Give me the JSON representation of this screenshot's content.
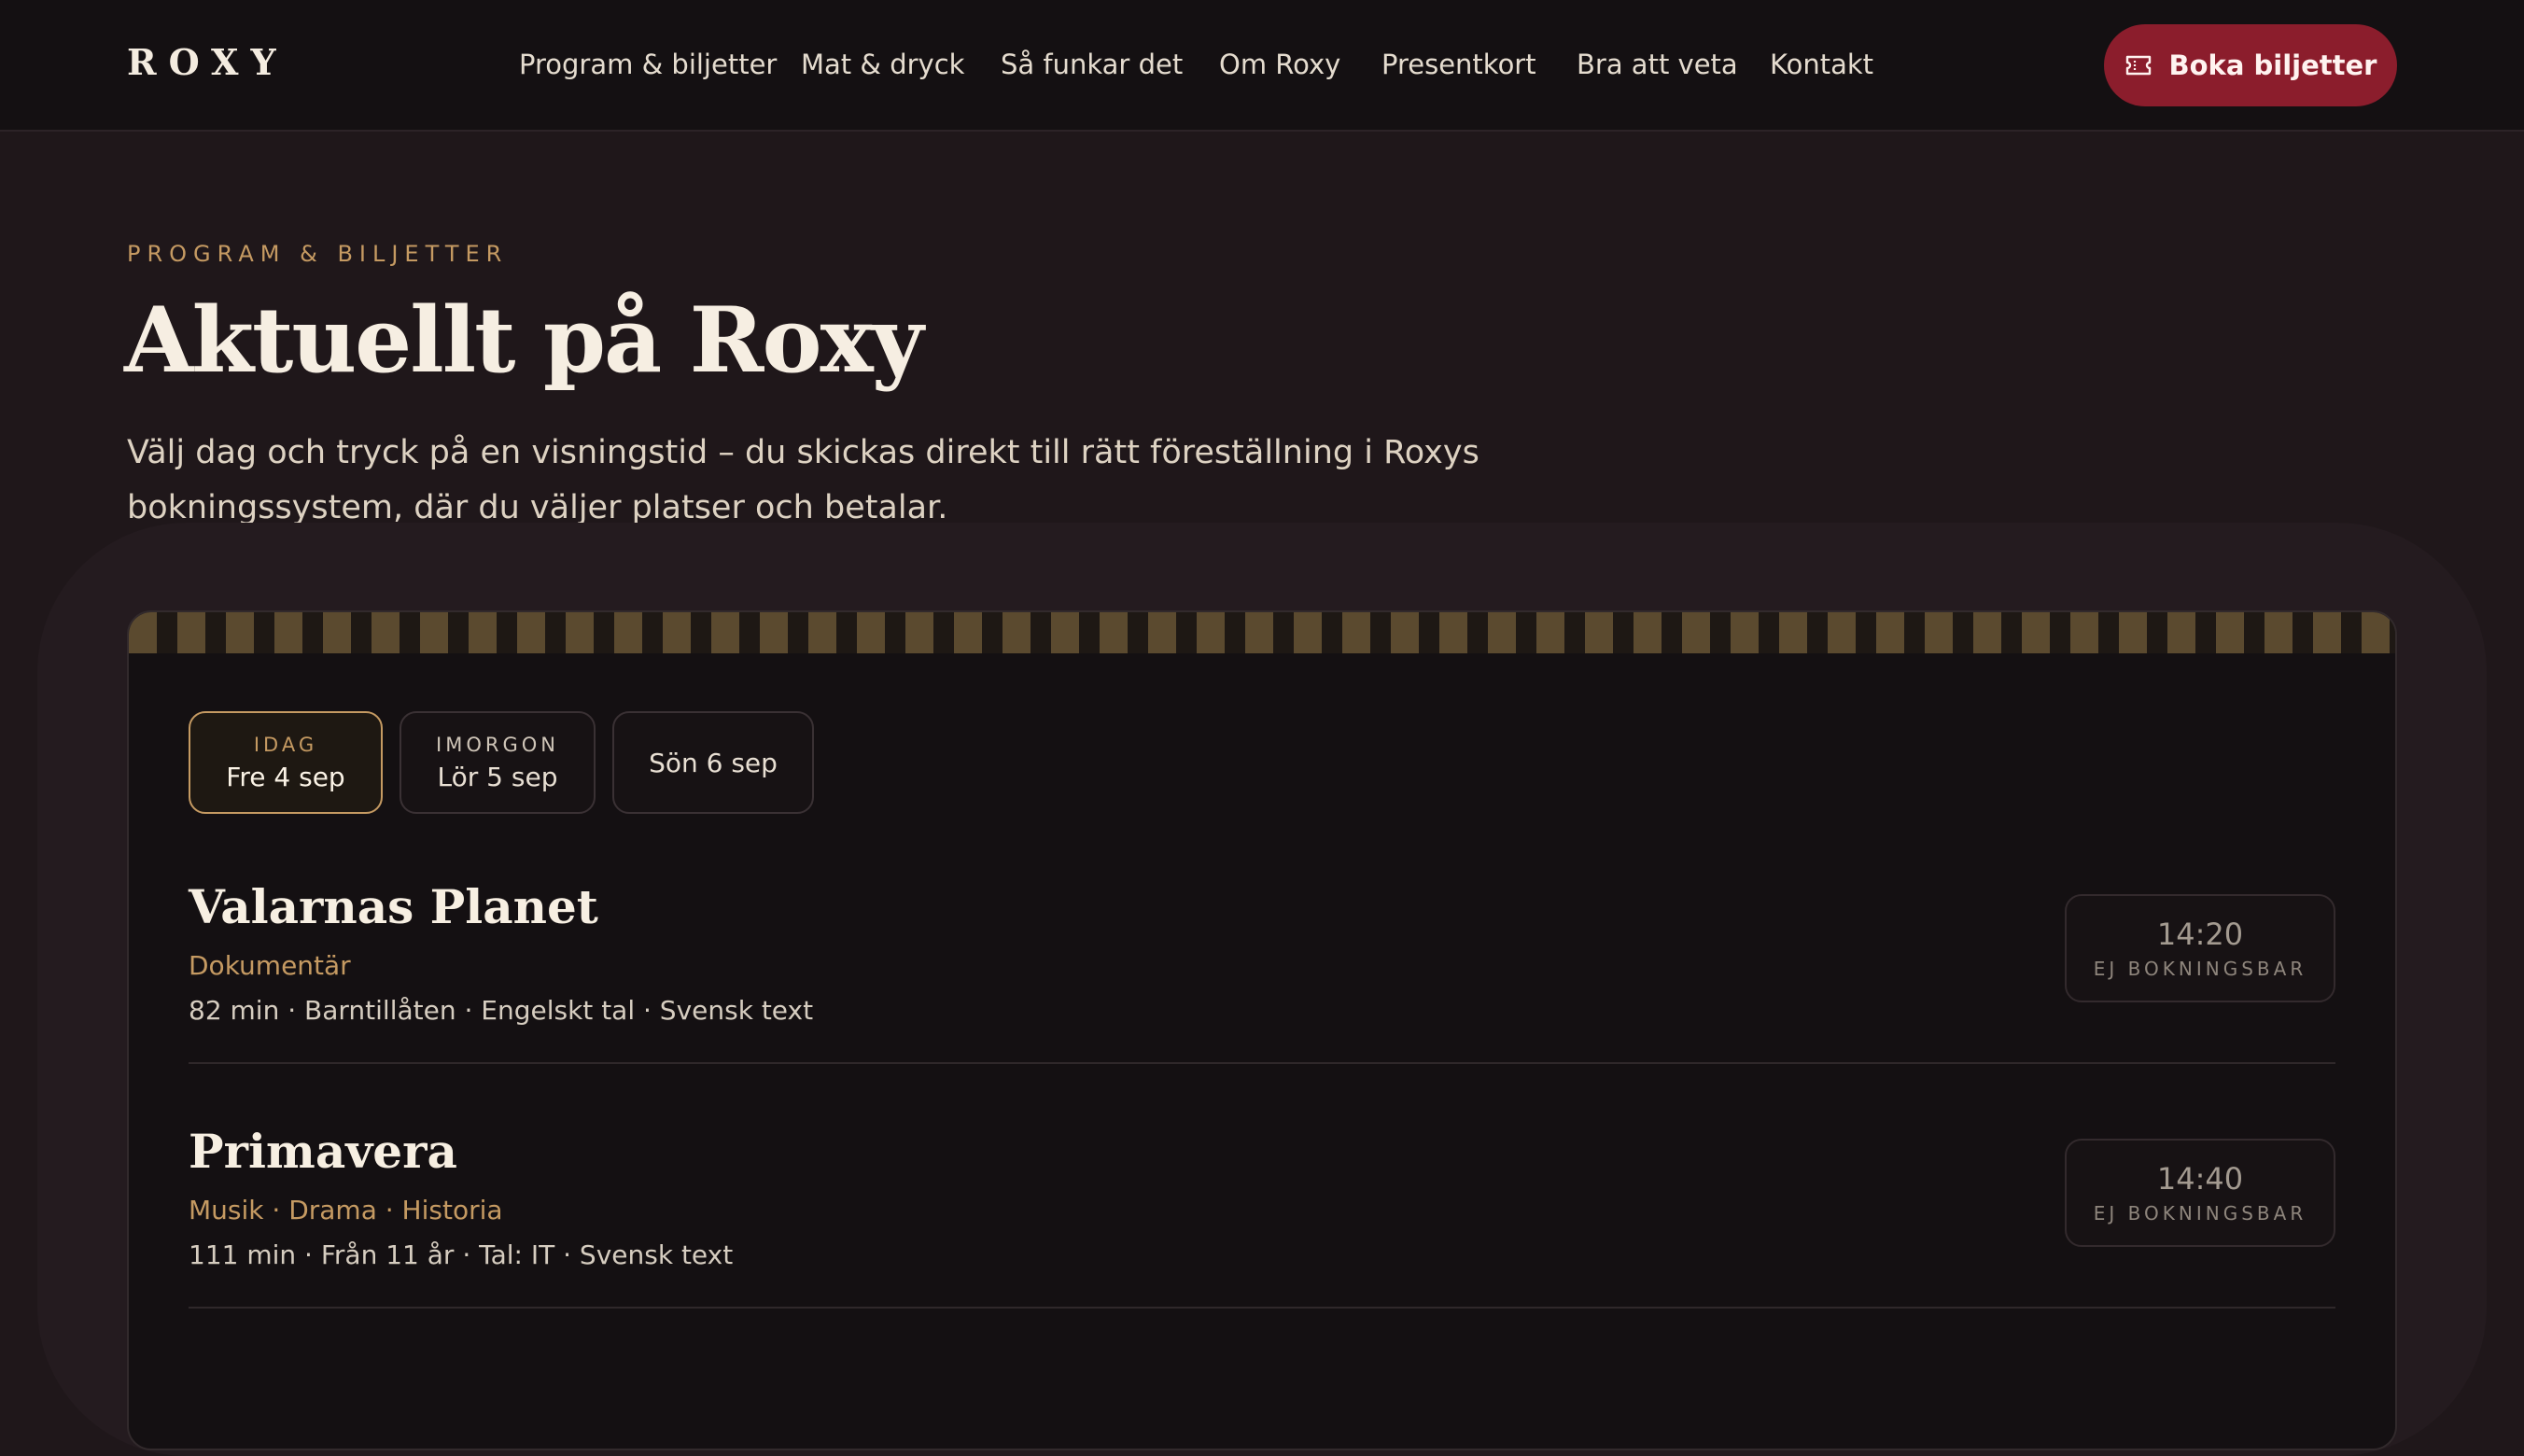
{
  "header": {
    "logo": "ROXY",
    "nav": [
      {
        "label": "Program & biljetter",
        "id": "program"
      },
      {
        "label": "Mat & dryck",
        "id": "mat"
      },
      {
        "label": "Så funkar det",
        "id": "sa-funkar"
      },
      {
        "label": "Om Roxy",
        "id": "om"
      },
      {
        "label": "Presentkort",
        "id": "presentkort"
      },
      {
        "label": "Bra att veta",
        "id": "bra-att-veta"
      },
      {
        "label": "Kontakt",
        "id": "kontakt"
      }
    ],
    "book_button": {
      "label": "Boka biljetter",
      "icon": "ticket-icon"
    }
  },
  "hero": {
    "eyebrow": "PROGRAM & BILJETTER",
    "title": "Aktuellt på Roxy",
    "lead": "Välj dag och tryck på en visningstid – du skickas direkt till rätt föreställning i Roxys bokningssystem, där du väljer platser och betalar."
  },
  "schedule": {
    "date_tabs": [
      {
        "top": "IDAG",
        "main": "Fre 4 sep",
        "active": true
      },
      {
        "top": "IMORGON",
        "main": "Lör 5 sep",
        "active": false
      },
      {
        "top": "",
        "main": "Sön 6 sep",
        "active": false
      }
    ],
    "films": [
      {
        "title": "Valarnas Planet",
        "genre": "Dokumentär",
        "meta": "82 min · Barntillåten · Engelskt tal · Svensk text",
        "showtime": {
          "time": "14:20",
          "status": "EJ BOKNINGSBAR"
        }
      },
      {
        "title": "Primavera",
        "genre": "Musik · Drama · Historia",
        "meta": "111 min · Från 11 år · Tal: IT · Svensk text",
        "showtime": {
          "time": "14:40",
          "status": "EJ BOKNINGSBAR"
        }
      }
    ]
  },
  "colors": {
    "background": "#1f171a",
    "header": "#141012",
    "accent_gold": "#c59a62",
    "brand_red": "#8b1d2c"
  }
}
